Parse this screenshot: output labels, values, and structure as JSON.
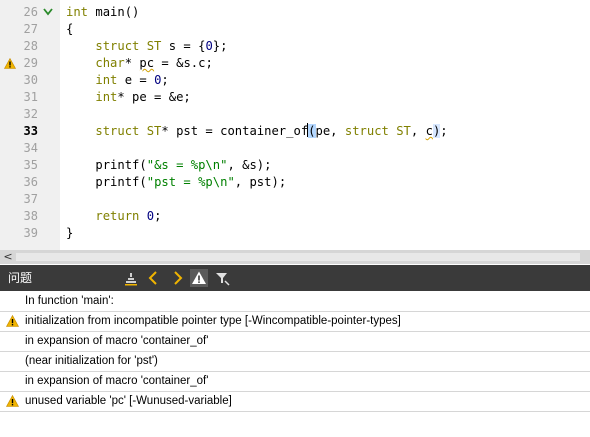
{
  "editor": {
    "lines": [
      {
        "num": "26",
        "fold": true,
        "warn": false,
        "current": false
      },
      {
        "num": "27",
        "fold": false,
        "warn": false,
        "current": false
      },
      {
        "num": "28",
        "fold": false,
        "warn": false,
        "current": false
      },
      {
        "num": "29",
        "fold": false,
        "warn": true,
        "current": false
      },
      {
        "num": "30",
        "fold": false,
        "warn": false,
        "current": false
      },
      {
        "num": "31",
        "fold": false,
        "warn": false,
        "current": false
      },
      {
        "num": "32",
        "fold": false,
        "warn": false,
        "current": false
      },
      {
        "num": "33",
        "fold": false,
        "warn": false,
        "current": true
      },
      {
        "num": "34",
        "fold": false,
        "warn": false,
        "current": false
      },
      {
        "num": "35",
        "fold": false,
        "warn": false,
        "current": false
      },
      {
        "num": "36",
        "fold": false,
        "warn": false,
        "current": false
      },
      {
        "num": "37",
        "fold": false,
        "warn": false,
        "current": false
      },
      {
        "num": "38",
        "fold": false,
        "warn": false,
        "current": false
      },
      {
        "num": "39",
        "fold": false,
        "warn": false,
        "current": false
      }
    ],
    "code": {
      "l26_kw": "int",
      "l26_rest": " main()",
      "l27": "{",
      "l28_ty": "struct ST",
      "l28_rest": " s = {",
      "l28_num": "0",
      "l28_end": "};",
      "l29_ty": "char",
      "l29_a": "* ",
      "l29_pc": "pc",
      "l29_rest": " = &s.c;",
      "l30_ty": "int",
      "l30_rest": " e = ",
      "l30_num": "0",
      "l30_end": ";",
      "l31_ty": "int",
      "l31_rest": "* pe = &e;",
      "l33_ty": "struct ST",
      "l33_a": "* pst = container_of",
      "l33_open": "(",
      "l33_b": "pe, ",
      "l33_ty2": "struct ST",
      "l33_c": ", ",
      "l33_cc": "c",
      "l33_close": ")",
      "l33_end": ";",
      "l35_a": "printf(",
      "l35_str": "\"&s = %p\\n\"",
      "l35_end": ", &s);",
      "l36_a": "printf(",
      "l36_str": "\"pst = %p\\n\"",
      "l36_end": ", pst);",
      "l38_kw": "return",
      "l38_sp": " ",
      "l38_num": "0",
      "l38_end": ";",
      "l39": "}"
    }
  },
  "scrollbar": {
    "left_arrow": "<"
  },
  "issues": {
    "title": "问题",
    "rows": [
      {
        "text": "In function 'main':",
        "warn": false
      },
      {
        "text": "initialization from incompatible pointer type [-Wincompatible-pointer-types]",
        "warn": true
      },
      {
        "text": "in expansion of macro 'container_of'",
        "warn": false
      },
      {
        "text": "(near initialization for 'pst')",
        "warn": false
      },
      {
        "text": "in expansion of macro 'container_of'",
        "warn": false
      },
      {
        "text": "unused variable 'pc' [-Wunused-variable]",
        "warn": true
      }
    ]
  },
  "colors": {
    "keyword": "#808000",
    "string": "#008000",
    "number": "#000080",
    "warning": "#f0b400",
    "panel_header": "#3a3a3a"
  }
}
